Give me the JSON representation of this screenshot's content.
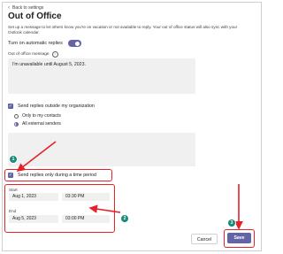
{
  "header": {
    "back_label": "Back to settings",
    "title": "Out of Office",
    "description": "Set up a message to let others know you're on vacation or not available to reply. Your out of office status will also sync with your Outlook calendar."
  },
  "auto_replies": {
    "toggle_label": "Turn on automatic replies",
    "enabled": true
  },
  "message": {
    "label": "Out of office message",
    "value": "I'm unavailable until August 5, 2023."
  },
  "outside_org": {
    "checkbox_label": "Send replies outside my organization",
    "checked": true,
    "options": [
      "Only to my contacts",
      "All external senders"
    ],
    "selected": "All external senders"
  },
  "period": {
    "checkbox_label": "Send replies only during a time period",
    "checked": true,
    "start_label": "Start",
    "start_date": "Aug 1, 2023",
    "start_time": "03:30 PM",
    "end_label": "End",
    "end_date": "Aug 5, 2023",
    "end_time": "03:00 PM"
  },
  "footer": {
    "cancel_label": "Cancel",
    "save_label": "Save"
  },
  "annotations": {
    "step1": "1",
    "step2": "2",
    "step3": "3",
    "highlight_color": "#e8202a",
    "badge_color": "#1a8a7a"
  },
  "accent_color": "#6264a7"
}
